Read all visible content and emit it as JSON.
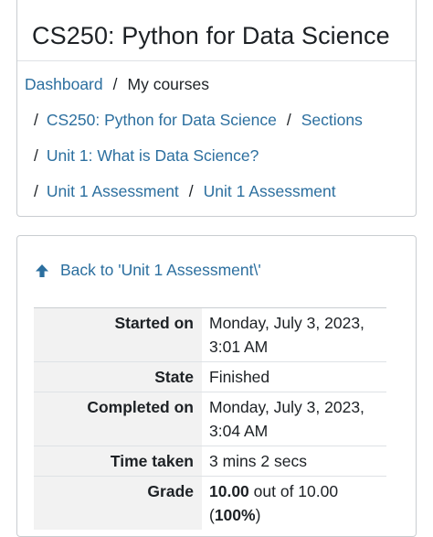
{
  "course": {
    "title": "CS250: Python for Data Science"
  },
  "breadcrumb": {
    "dashboard": "Dashboard",
    "my_courses": "My courses",
    "course": "CS250: Python for Data Science",
    "sections": "Sections",
    "unit": "Unit 1: What is Data Science?",
    "assessment1": "Unit 1 Assessment",
    "assessment2": "Unit 1 Assessment",
    "separator": "/"
  },
  "back": {
    "label": "Back to 'Unit 1 Assessment\\'",
    "icon": "arrow-up-icon"
  },
  "summary": {
    "started_label": "Started on",
    "started_value_line1": "Monday, July 3, 2023,",
    "started_value_line2": "3:01 AM",
    "state_label": "State",
    "state_value": "Finished",
    "completed_label": "Completed on",
    "completed_value_line1": "Monday, July 3, 2023,",
    "completed_value_line2": "3:04 AM",
    "time_label": "Time taken",
    "time_value": "3 mins 2 secs",
    "grade_label": "Grade",
    "grade_score": "10.00",
    "grade_out_of": " out of 10.00",
    "grade_open": "(",
    "grade_percent": "100%",
    "grade_close": ")"
  },
  "colors": {
    "link": "#2c6f9f",
    "text": "#1d2125",
    "header_cell": "#f2f2f2"
  }
}
